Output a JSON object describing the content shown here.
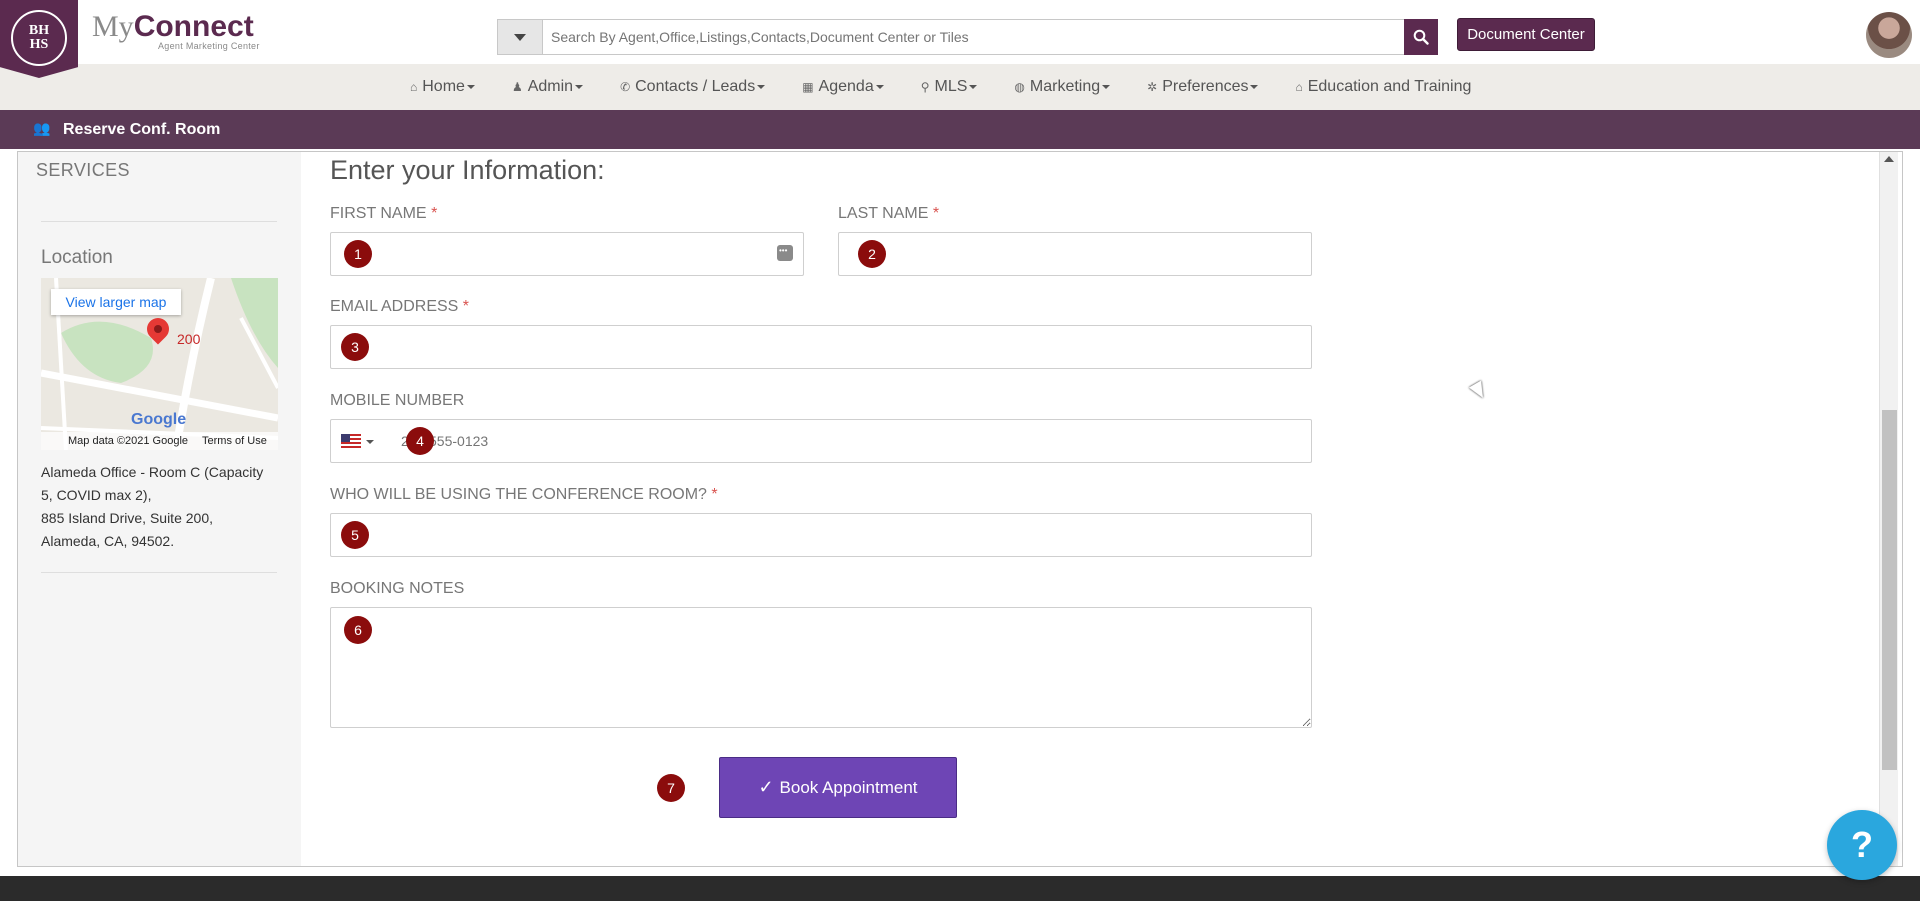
{
  "header": {
    "logo_line1": "BH",
    "logo_line2": "HS",
    "brand_my": "My",
    "brand_connect": "Connect",
    "brand_sub": "Agent Marketing Center",
    "search_placeholder": "Search By Agent,Office,Listings,Contacts,Document Center or Tiles",
    "document_center_label": "Document Center"
  },
  "nav": {
    "items": [
      {
        "label": "Home",
        "icon": "home-icon",
        "dropdown": true
      },
      {
        "label": "Admin",
        "icon": "user-icon",
        "dropdown": true
      },
      {
        "label": "Contacts / Leads",
        "icon": "phone-icon",
        "dropdown": true
      },
      {
        "label": "Agenda",
        "icon": "calendar-icon",
        "dropdown": true
      },
      {
        "label": "MLS",
        "icon": "search-icon",
        "dropdown": true
      },
      {
        "label": "Marketing",
        "icon": "globe-icon",
        "dropdown": true
      },
      {
        "label": "Preferences",
        "icon": "gear-icon",
        "dropdown": true
      },
      {
        "label": "Education and Training",
        "icon": "bank-icon",
        "dropdown": false
      }
    ]
  },
  "subbar": {
    "title": "Reserve Conf. Room"
  },
  "sidebar": {
    "services": "SERVICES",
    "location_title": "Location",
    "map": {
      "view_larger": "View larger map",
      "marker_label": "200",
      "google": "Google",
      "map_data": "Map data ©2021 Google",
      "terms": "Terms of Use"
    },
    "address_lines": [
      "Alameda Office - Room C (Capacity",
      "5, COVID max 2),",
      "885 Island Drive, Suite 200,",
      "Alameda, CA, 94502."
    ]
  },
  "form": {
    "title": "Enter your Information:",
    "first_name_label": "FIRST NAME",
    "last_name_label": "LAST NAME",
    "email_label": "EMAIL ADDRESS",
    "mobile_label": "MOBILE NUMBER",
    "mobile_placeholder": "201-555-0123",
    "who_label": "WHO WILL BE USING THE CONFERENCE ROOM?",
    "notes_label": "BOOKING NOTES",
    "required_mark": "*",
    "submit_label": "Book Appointment"
  },
  "badges": [
    "1",
    "2",
    "3",
    "4",
    "5",
    "6",
    "7"
  ],
  "help_label": "?",
  "colors": {
    "brand": "#5b2a4f",
    "subbar": "#5b3a56",
    "button": "#6e45b5",
    "badge": "#8b0c0c",
    "help": "#2aa7de"
  }
}
